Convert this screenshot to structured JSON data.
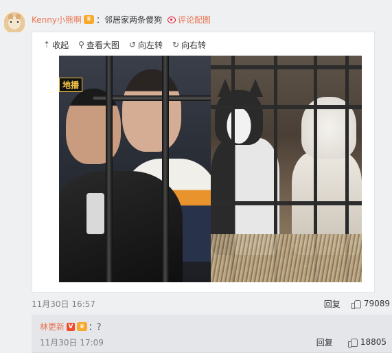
{
  "comment": {
    "username": "Kenny小熊啊",
    "badge": "VIP",
    "text": "：邻居家两条傻狗",
    "image_comment_link": "评论配图",
    "timestamp": "11月30日 16:57",
    "reply_label": "回复",
    "like_count": "79089"
  },
  "media_toolbar": {
    "collapse": "收起",
    "view_large": "查看大图",
    "rotate_left": "向左转",
    "rotate_right": "向右转"
  },
  "photo_overlay": {
    "show_logo": "地播"
  },
  "reply": {
    "username": "林更新",
    "verified_badge": "V",
    "vip_badge": "VIP",
    "text": "：？",
    "timestamp": "11月30日 17:09",
    "reply_label": "回复",
    "like_count": "18805"
  },
  "colors": {
    "username": "#eb7350",
    "timestamp": "#808080",
    "background": "#eef0f2",
    "reply_background": "#e4e6ea"
  },
  "icons": {
    "collapse": "arrow-up-icon",
    "view_large": "magnifier-icon",
    "rotate_left": "rotate-left-icon",
    "rotate_right": "rotate-right-icon",
    "like": "thumbs-up-icon",
    "image_comment": "weibo-icon"
  }
}
